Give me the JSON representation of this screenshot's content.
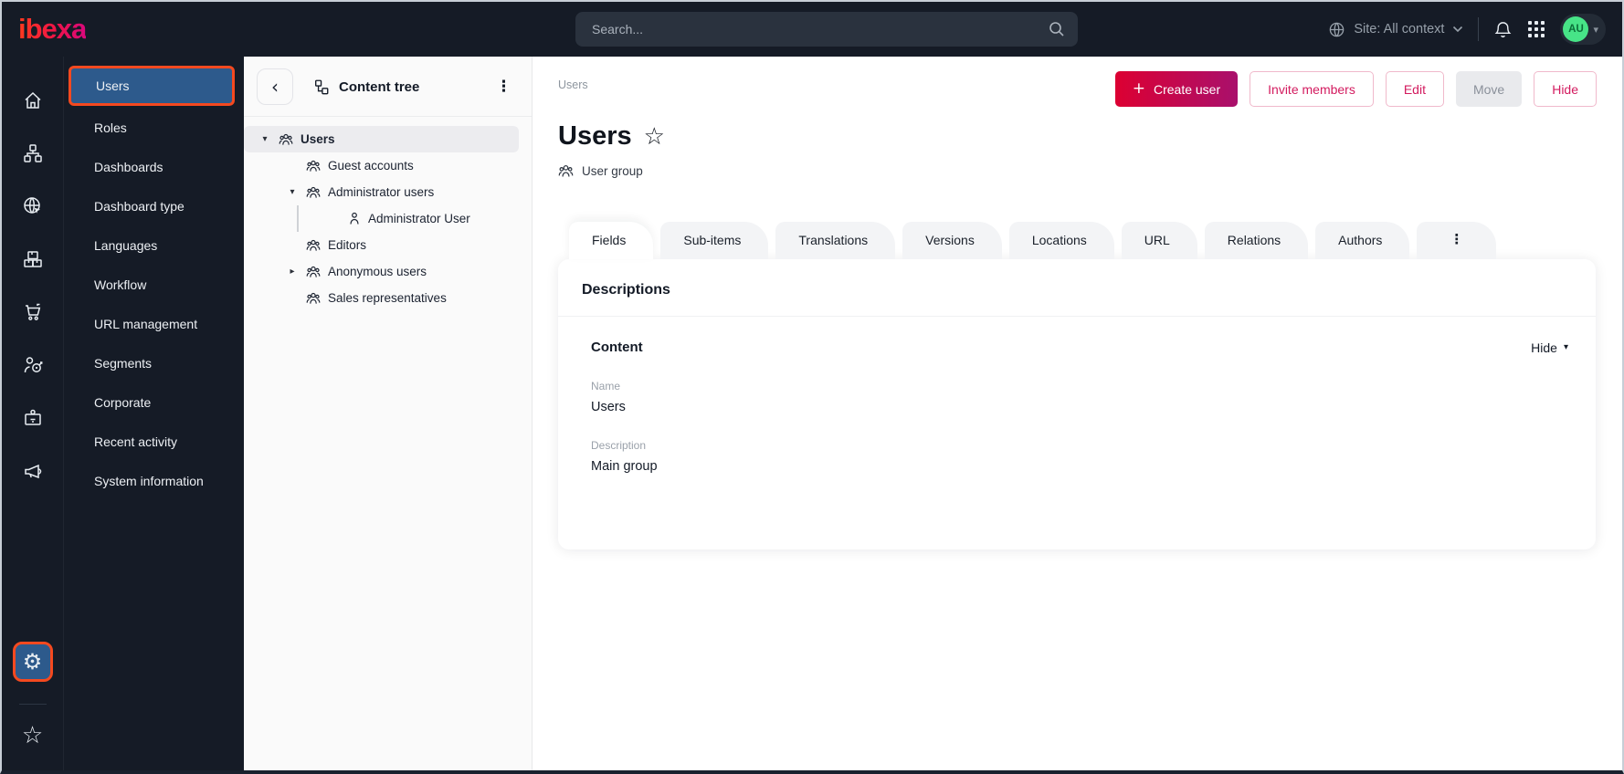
{
  "colors": {
    "topbar_bg": "#151b26",
    "accent_orange": "#f4491f",
    "selected_blue": "#2d5a8c",
    "primary_red": "#dc0032",
    "primary_magenta": "#a9106c",
    "outline_pink_text": "#d31b5f",
    "avatar_green": "#47e487",
    "panel_bg": "#fafafa"
  },
  "topbar": {
    "logo_text": "ibexa",
    "search_placeholder": "Search...",
    "site_context_label": "Site: All context",
    "avatar_initials": "AU"
  },
  "icon_rail": {
    "items": [
      "home-icon",
      "site-structure-icon",
      "web-globe-icon",
      "products-boxes-icon",
      "commerce-cart-icon",
      "personalization-target-icon",
      "corporate-badge-icon",
      "marketing-megaphone-icon"
    ],
    "bottom_items": [
      "admin-gear-icon",
      "bookmarks-star-icon"
    ]
  },
  "sidebar": {
    "items": [
      "Users",
      "Roles",
      "Dashboards",
      "Dashboard type",
      "Languages",
      "Workflow",
      "URL management",
      "Segments",
      "Corporate",
      "Recent activity",
      "System information"
    ],
    "active_item": "Users"
  },
  "content_tree": {
    "title": "Content tree",
    "nodes": [
      {
        "label": "Users",
        "level": 0,
        "state": "expanded",
        "selected": true,
        "icon": "user-group-icon"
      },
      {
        "label": "Guest accounts",
        "level": 1,
        "state": "leaf",
        "icon": "user-group-icon"
      },
      {
        "label": "Administrator users",
        "level": 1,
        "state": "expanded",
        "icon": "user-group-icon"
      },
      {
        "label": "Administrator User",
        "level": 2,
        "state": "leaf",
        "icon": "user-icon"
      },
      {
        "label": "Editors",
        "level": 1,
        "state": "leaf",
        "icon": "user-group-icon"
      },
      {
        "label": "Anonymous users",
        "level": 1,
        "state": "collapsed",
        "icon": "user-group-icon"
      },
      {
        "label": "Sales representatives",
        "level": 1,
        "state": "leaf",
        "icon": "user-group-icon"
      }
    ]
  },
  "main": {
    "breadcrumb": "Users",
    "actions": {
      "create_user": "Create user",
      "invite_members": "Invite members",
      "edit": "Edit",
      "move": "Move",
      "hide": "Hide"
    },
    "title": "Users",
    "content_type_label": "User group",
    "tabs": [
      "Fields",
      "Sub-items",
      "Translations",
      "Versions",
      "Locations",
      "URL",
      "Relations",
      "Authors"
    ],
    "active_tab": "Fields",
    "card": {
      "heading": "Descriptions",
      "section_heading": "Content",
      "toggle_label": "Hide",
      "fields": [
        {
          "label": "Name",
          "value": "Users"
        },
        {
          "label": "Description",
          "value": "Main group"
        }
      ]
    }
  },
  "icons": {
    "caret_down": "▾",
    "caret_right": "▸",
    "kebab": "⋮",
    "gear": "⚙",
    "star": "☆",
    "back_chevron": "‹",
    "plus": "+",
    "chevron_down": "▾"
  }
}
